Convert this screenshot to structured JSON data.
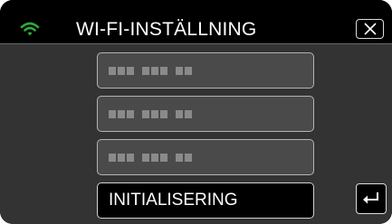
{
  "header": {
    "title": "WI-FI-INSTÄLLNING",
    "wifi_icon": "wifi-icon",
    "wifi_color": "#2fa83a",
    "close_icon": "close-icon"
  },
  "network_items": [
    {
      "masked_name_icon": "masked-text-icon"
    },
    {
      "masked_name_icon": "masked-text-icon"
    },
    {
      "masked_name_icon": "masked-text-icon"
    }
  ],
  "init_button": {
    "label": "INITIALISERING"
  },
  "back_button": {
    "icon": "return-arrow-icon"
  }
}
